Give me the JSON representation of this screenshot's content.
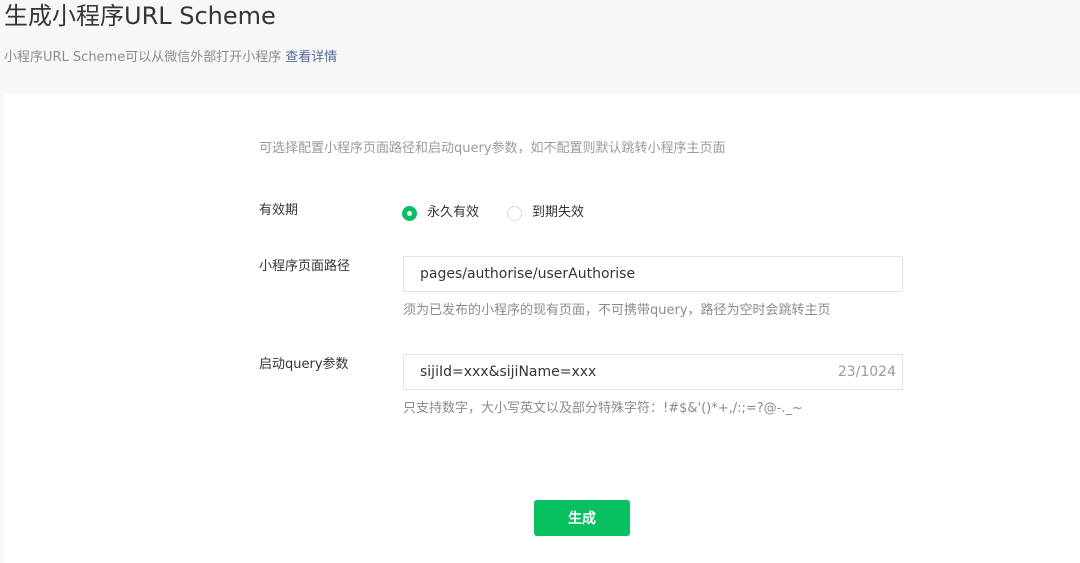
{
  "header": {
    "title": "生成小程序URL Scheme",
    "subtitle": "小程序URL Scheme可以从微信外部打开小程序",
    "details_link": "查看详情"
  },
  "form": {
    "hint": "可选择配置小程序页面路径和启动query参数，如不配置则默认跳转小程序主页面",
    "validity": {
      "label": "有效期",
      "options": [
        {
          "label": "永久有效",
          "checked": true
        },
        {
          "label": "到期失效",
          "checked": false
        }
      ]
    },
    "page_path": {
      "label": "小程序页面路径",
      "value": "pages/authorise/userAuthorise",
      "description": "须为已发布的小程序的现有页面，不可携带query，路径为空时会跳转主页"
    },
    "query": {
      "label": "启动query参数",
      "value": "sijiId=xxx&sijiName=xxx",
      "counter": "23/1024",
      "description": "只支持数字，大小写英文以及部分特殊字符：!#$&'()*+,/:;=?@-._~"
    },
    "submit_label": "生成"
  },
  "colors": {
    "primary": "#07c160",
    "link": "#576b95"
  }
}
